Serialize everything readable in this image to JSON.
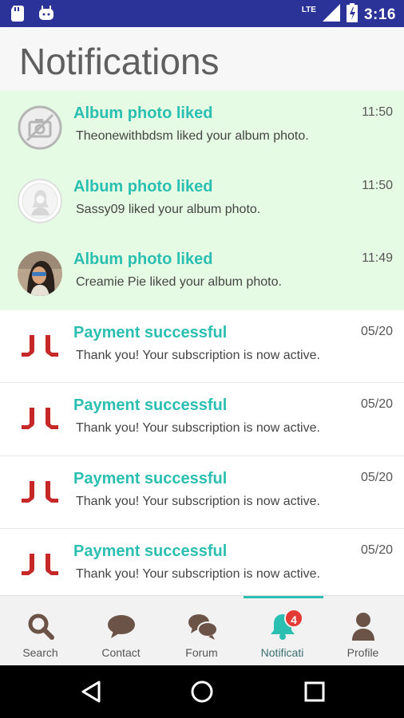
{
  "status_bar": {
    "time": "3:16",
    "network": "LTE",
    "left_icons": [
      "sd-card-icon",
      "android-icon"
    ],
    "right_icons": [
      "signal-icon",
      "battery-charging-icon"
    ]
  },
  "header": {
    "title": "Notifications"
  },
  "notifications": [
    {
      "type": "album-like",
      "unread": true,
      "avatar": "no-photo-icon",
      "title": "Album photo liked",
      "body": "Theonewithbdsm liked your album photo.",
      "time": "11:50"
    },
    {
      "type": "album-like",
      "unread": true,
      "avatar": "female-silhouette-icon",
      "title": "Album photo liked",
      "body": "Sassy09 liked your album photo.",
      "time": "11:50"
    },
    {
      "type": "album-like",
      "unread": true,
      "avatar": "user-photo",
      "title": "Album photo liked",
      "body": "Creamie Pie liked your album photo.",
      "time": "11:49"
    },
    {
      "type": "payment",
      "unread": false,
      "avatar": "brand-logo-icon",
      "title": "Payment successful",
      "body": "Thank you! Your subscription is now active.",
      "time": "05/20"
    },
    {
      "type": "payment",
      "unread": false,
      "avatar": "brand-logo-icon",
      "title": "Payment successful",
      "body": "Thank you! Your subscription is now active.",
      "time": "05/20"
    },
    {
      "type": "payment",
      "unread": false,
      "avatar": "brand-logo-icon",
      "title": "Payment successful",
      "body": "Thank you! Your subscription is now active.",
      "time": "05/20"
    },
    {
      "type": "payment",
      "unread": false,
      "avatar": "brand-logo-icon",
      "title": "Payment successful",
      "body": "Thank you! Your subscription is now active.",
      "time": "05/20"
    }
  ],
  "bottom_nav": {
    "items": [
      {
        "label": "Search",
        "icon": "search-icon"
      },
      {
        "label": "Contact",
        "icon": "chat-bubble-icon"
      },
      {
        "label": "Forum",
        "icon": "forum-icon"
      },
      {
        "label": "Notificati",
        "icon": "bell-icon",
        "active": true,
        "badge": "4"
      },
      {
        "label": "Profile",
        "icon": "person-icon"
      }
    ]
  },
  "colors": {
    "status_bar": "#2b3398",
    "accent": "#2bbfb1",
    "unread_bg": "#e6fbe4",
    "brand_red": "#c62828",
    "badge": "#e53935"
  }
}
